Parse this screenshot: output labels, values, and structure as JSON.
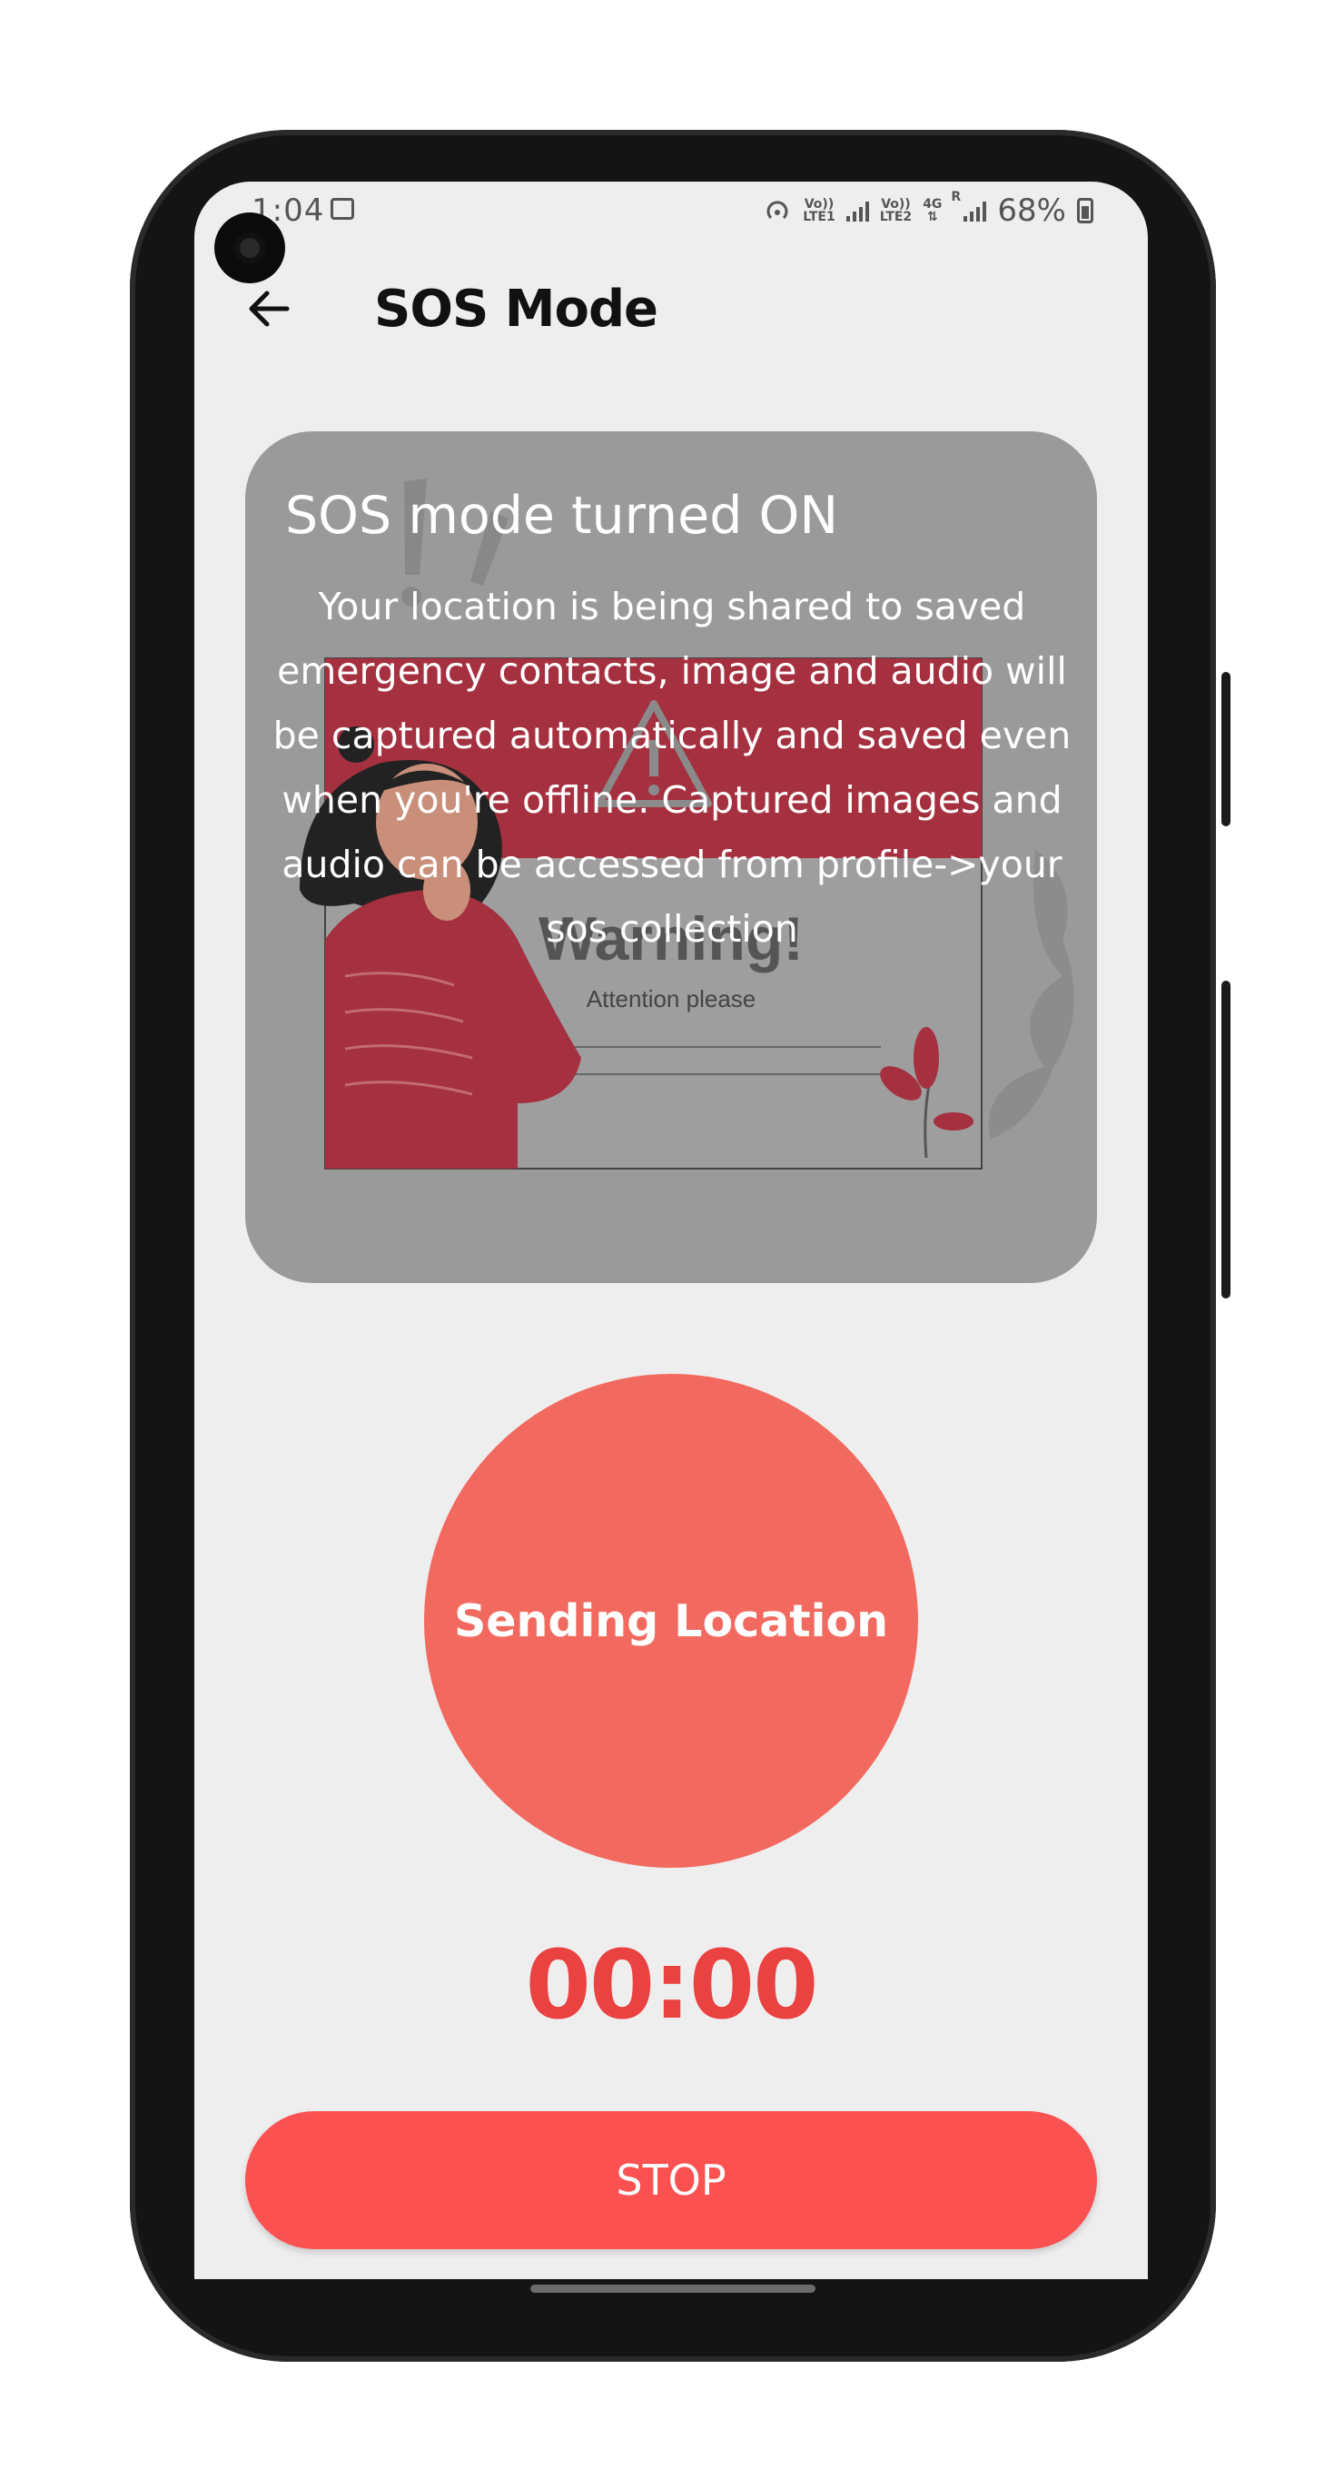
{
  "status_bar": {
    "time": "1:04",
    "sim1_top": "Vo))",
    "sim1_bottom": "LTE1",
    "sim2_top": "Vo))",
    "sim2_bottom": "LTE2",
    "network": "4G",
    "roaming": "R",
    "battery_pct": "68%"
  },
  "app_bar": {
    "title": "SOS Mode",
    "back_icon": "arrow-left-icon"
  },
  "card": {
    "title": "SOS mode turned ON",
    "body": "Your location is being shared to saved emergency contacts, image and audio will be captured automatically and saved even when you're offline. Captured images and audio can be accessed from profile->your sos collection",
    "illustration_heading": "Warning!",
    "illustration_sub": "Attention please"
  },
  "sos": {
    "circle_label": "Sending Location",
    "timer": "00:00",
    "stop_label": "STOP"
  },
  "colors": {
    "background": "#efeeef",
    "card": "#9a9a9a",
    "circle": "#f26a5f",
    "timer": "#ea4141",
    "stop_button": "#fc5151"
  }
}
